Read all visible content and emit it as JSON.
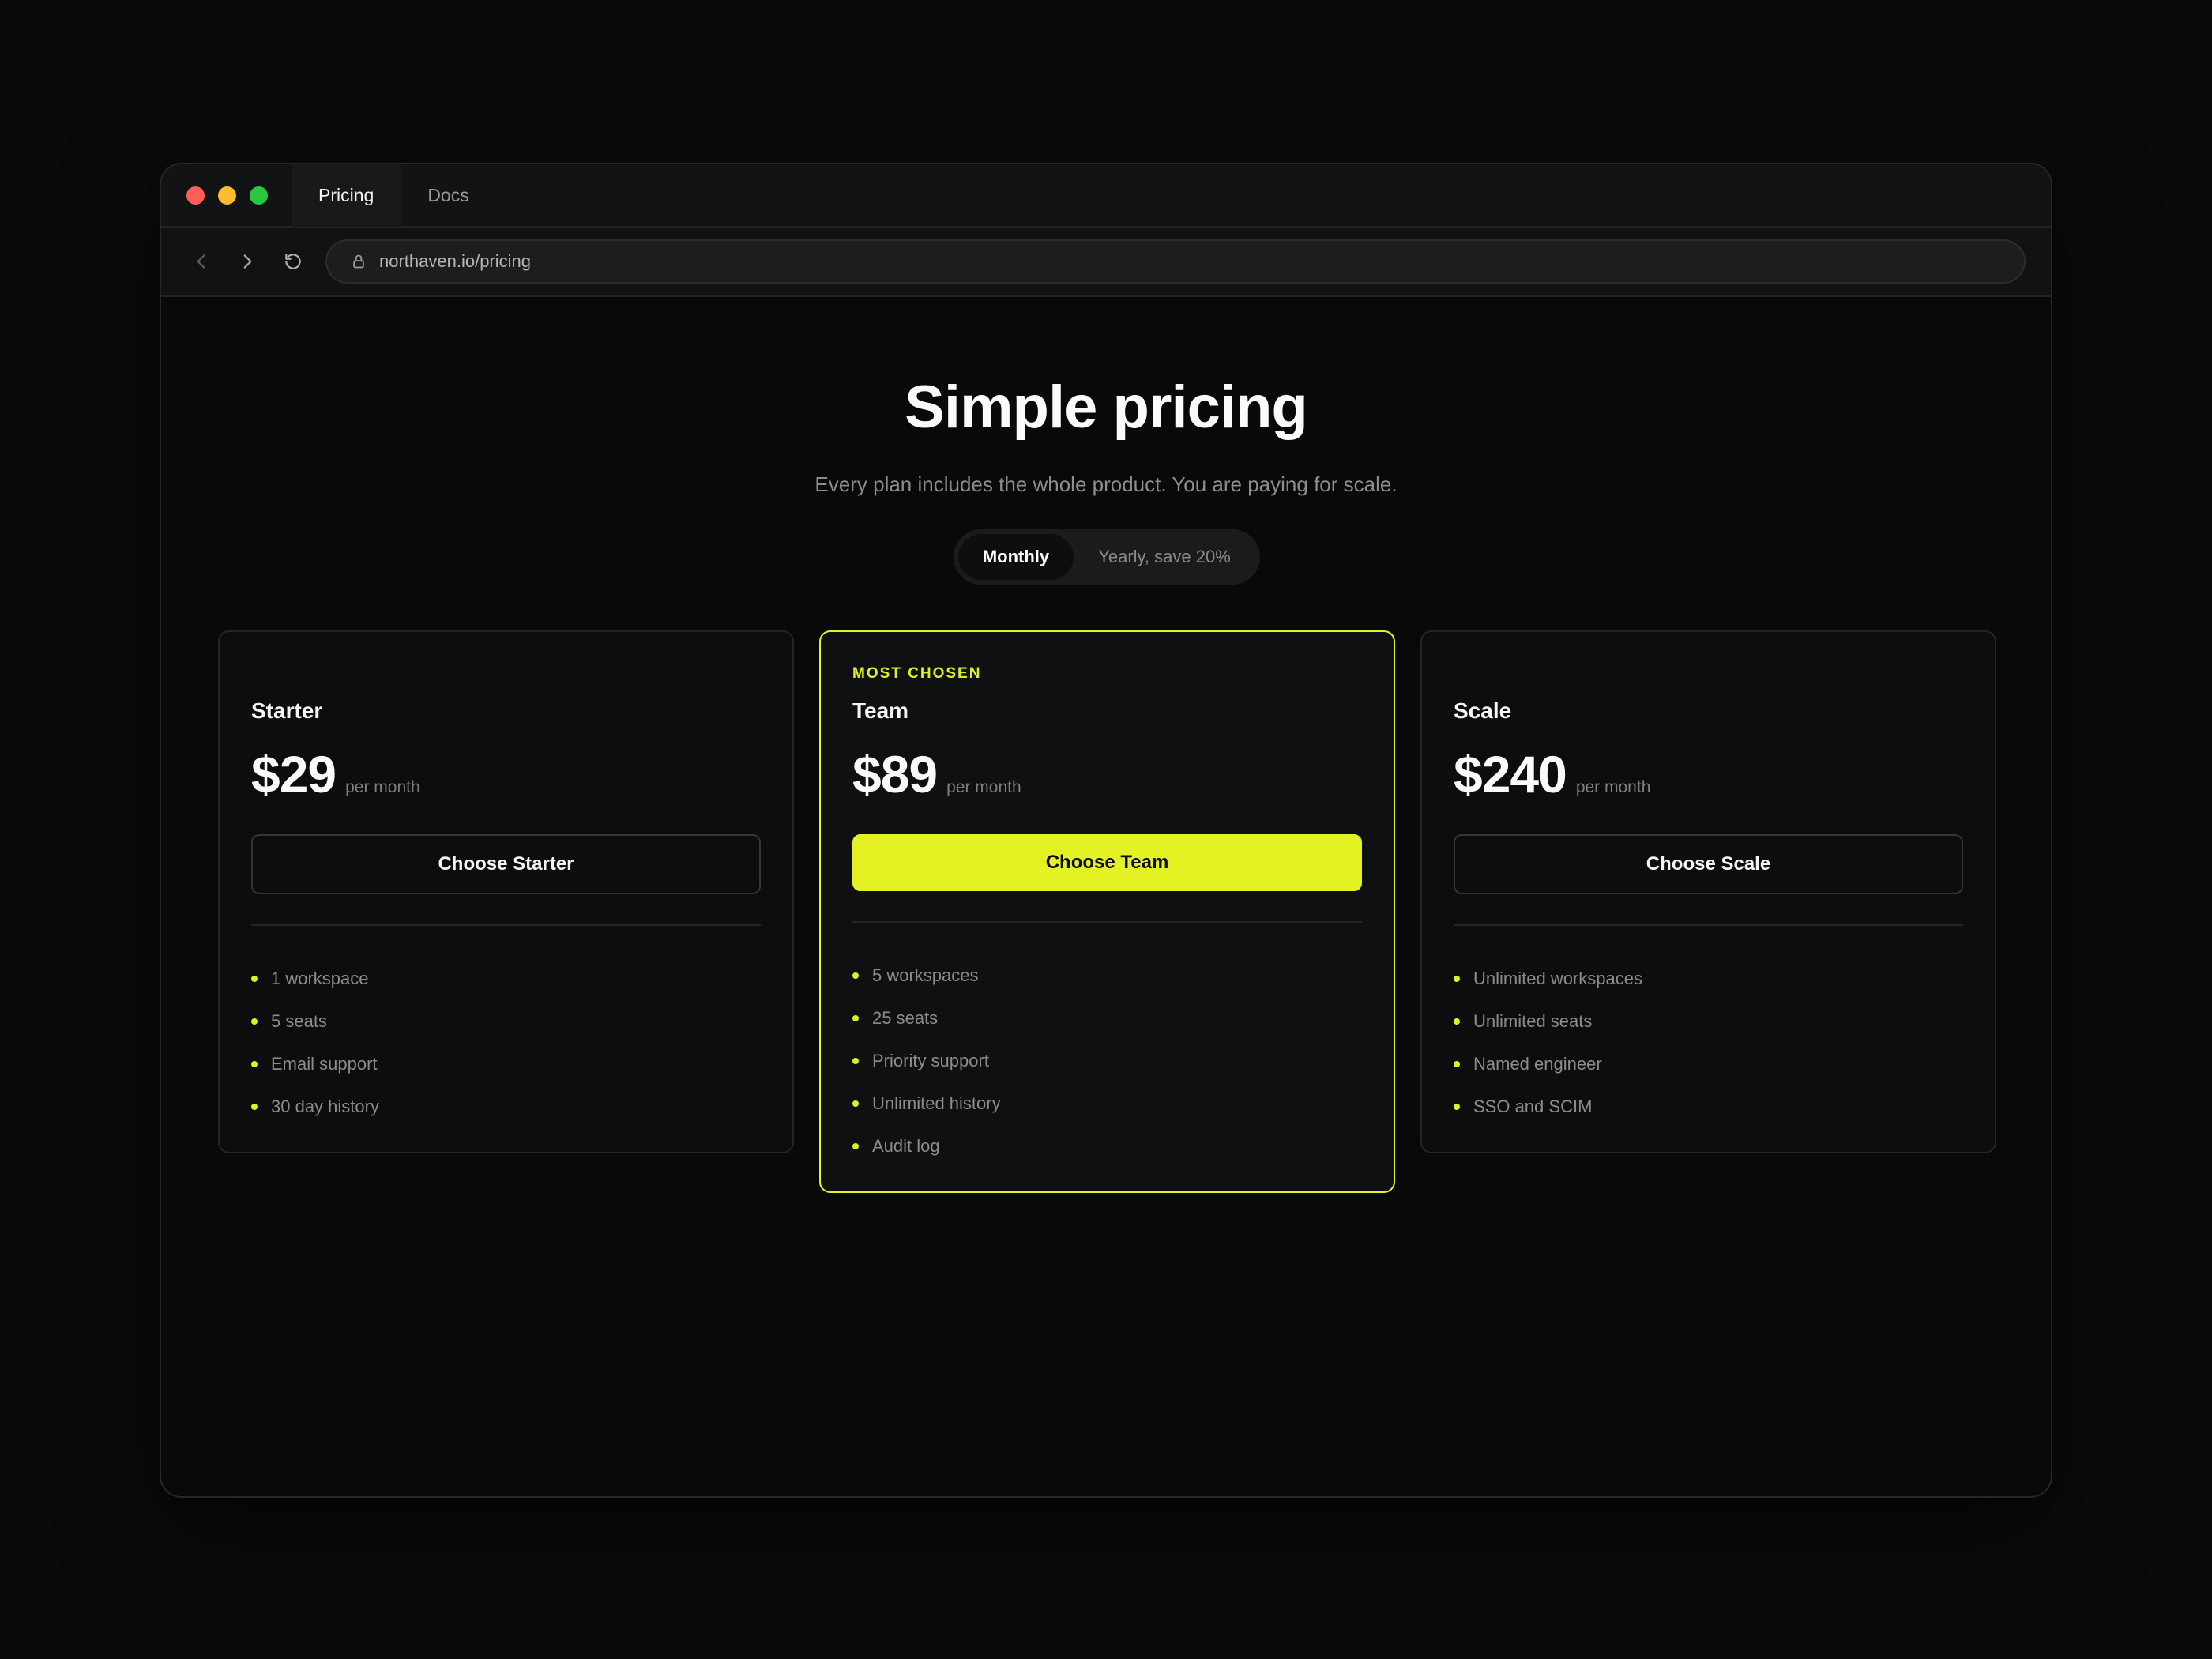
{
  "browser": {
    "tabs": [
      {
        "label": "Pricing",
        "active": true
      },
      {
        "label": "Docs",
        "active": false
      }
    ],
    "url": "northaven.io/pricing",
    "traffic_lights": [
      "#ff5f57",
      "#febc2e",
      "#28c840"
    ]
  },
  "hero": {
    "title": "Simple pricing",
    "subtitle": "Every plan includes the whole product. You are paying for scale."
  },
  "billing_toggle": {
    "monthly": "Monthly",
    "yearly": "Yearly, save 20%",
    "selected": "Monthly"
  },
  "accent_color": "#e4f223",
  "plans": [
    {
      "eyebrow": "",
      "name": "Starter",
      "price": "$29",
      "period": "per month",
      "cta": "Choose Starter",
      "features": [
        "1 workspace",
        "5 seats",
        "Email support",
        "30 day history"
      ]
    },
    {
      "eyebrow": "MOST CHOSEN",
      "name": "Team",
      "price": "$89",
      "period": "per month",
      "cta": "Choose Team",
      "features": [
        "5 workspaces",
        "25 seats",
        "Priority support",
        "Unlimited history",
        "Audit log"
      ]
    },
    {
      "eyebrow": "",
      "name": "Scale",
      "price": "$240",
      "period": "per month",
      "cta": "Choose Scale",
      "features": [
        "Unlimited workspaces",
        "Unlimited seats",
        "Named engineer",
        "SSO and SCIM"
      ]
    }
  ]
}
